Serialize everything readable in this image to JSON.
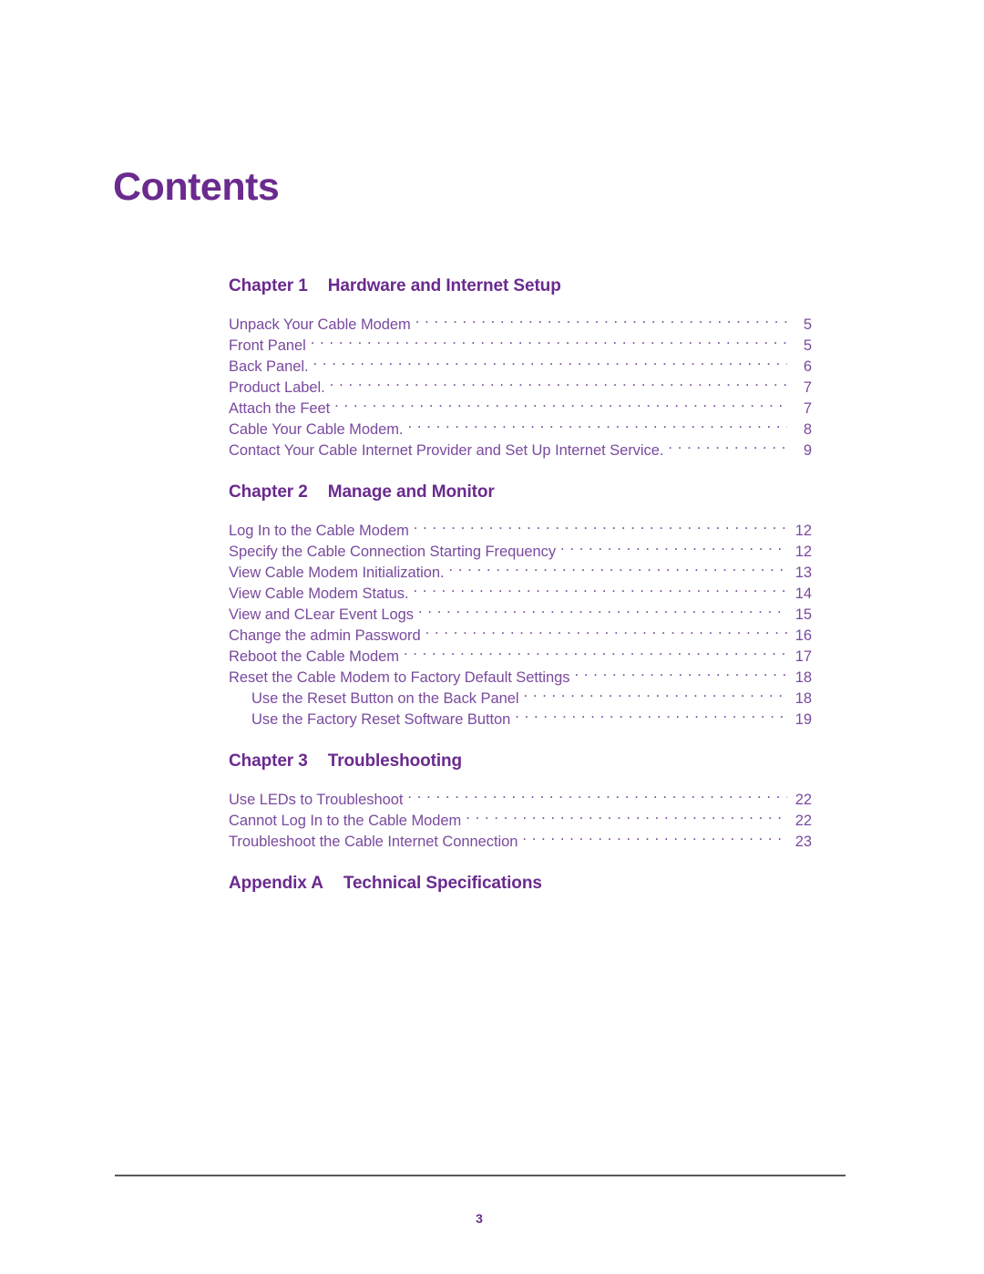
{
  "document": {
    "title": "Contents",
    "page_number": "3"
  },
  "toc": {
    "sections": [
      {
        "kind": "Chapter",
        "number": "Chapter 1",
        "title": "Hardware and Internet Setup",
        "entries": [
          {
            "label": "Unpack Your Cable Modem",
            "page": "5",
            "level": 1
          },
          {
            "label": "Front Panel",
            "page": "5",
            "level": 1
          },
          {
            "label": "Back Panel.",
            "page": "6",
            "level": 1
          },
          {
            "label": "Product Label.",
            "page": "7",
            "level": 1
          },
          {
            "label": "Attach the Feet",
            "page": "7",
            "level": 1
          },
          {
            "label": "Cable Your Cable Modem.",
            "page": "8",
            "level": 1
          },
          {
            "label": "Contact Your Cable Internet Provider and Set Up Internet Service.",
            "page": "9",
            "level": 1
          }
        ]
      },
      {
        "kind": "Chapter",
        "number": "Chapter 2",
        "title": "Manage and Monitor",
        "entries": [
          {
            "label": "Log In to the Cable Modem",
            "page": "12",
            "level": 1
          },
          {
            "label": "Specify the Cable Connection Starting Frequency",
            "page": "12",
            "level": 1
          },
          {
            "label": "View Cable Modem Initialization.",
            "page": "13",
            "level": 1
          },
          {
            "label": "View Cable Modem Status.",
            "page": "14",
            "level": 1
          },
          {
            "label": "View and CLear Event Logs",
            "page": "15",
            "level": 1
          },
          {
            "label": "Change the admin Password",
            "page": "16",
            "level": 1
          },
          {
            "label": "Reboot the Cable Modem",
            "page": "17",
            "level": 1
          },
          {
            "label": "Reset the Cable Modem to Factory Default Settings",
            "page": "18",
            "level": 1
          },
          {
            "label": "Use the Reset Button on the Back Panel",
            "page": "18",
            "level": 2
          },
          {
            "label": "Use the Factory Reset Software Button",
            "page": "19",
            "level": 2
          }
        ]
      },
      {
        "kind": "Chapter",
        "number": "Chapter 3",
        "title": "Troubleshooting",
        "entries": [
          {
            "label": "Use LEDs to Troubleshoot",
            "page": "22",
            "level": 1
          },
          {
            "label": "Cannot Log In to the Cable Modem",
            "page": "22",
            "level": 1
          },
          {
            "label": "Troubleshoot the Cable Internet Connection",
            "page": "23",
            "level": 1
          }
        ]
      },
      {
        "kind": "Appendix",
        "number": "Appendix A",
        "title": "Technical Specifications",
        "entries": []
      }
    ]
  },
  "colors": {
    "heading_purple": "#6a2a8e",
    "entry_purple": "#7a4a9e",
    "footer_rule": "#595959",
    "background": "#ffffff"
  }
}
